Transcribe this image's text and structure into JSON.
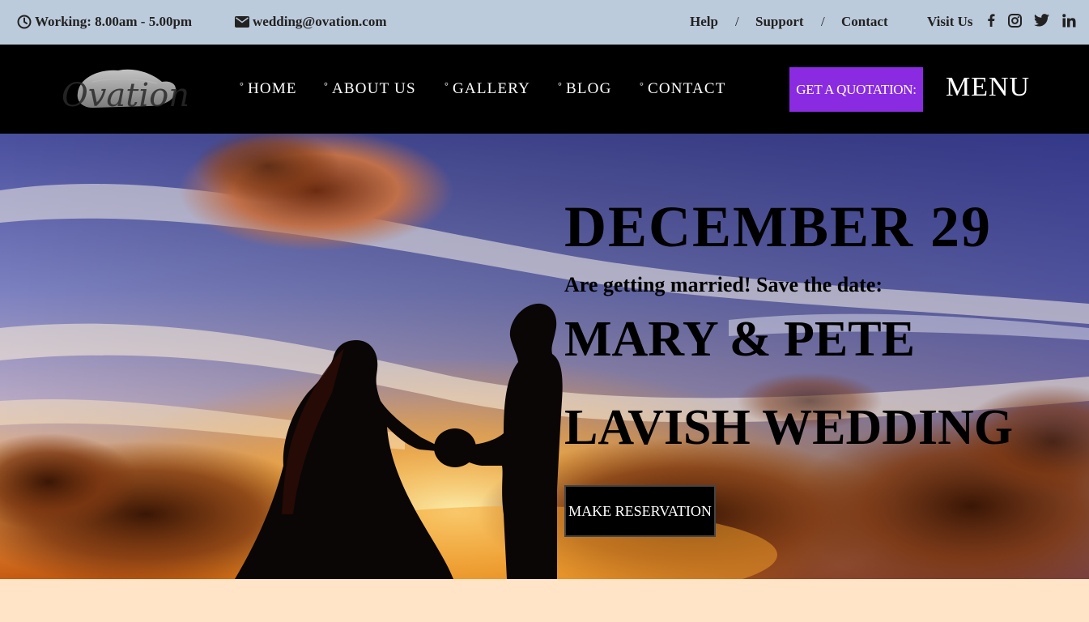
{
  "topbar": {
    "hours": "Working: 8.00am - 5.00pm",
    "email": "wedding@ovation.com",
    "links": {
      "help": "Help",
      "support": "Support",
      "contact": "Contact"
    },
    "separator": "/",
    "visit_us": "Visit Us",
    "social_icons": [
      "facebook-icon",
      "instagram-icon",
      "twitter-icon",
      "linkedin-icon"
    ]
  },
  "navbar": {
    "logo_text": "Ovation",
    "bullet": "°",
    "items": [
      {
        "label": "HOME"
      },
      {
        "label": "ABOUT US"
      },
      {
        "label": "GALLERY"
      },
      {
        "label": "BLOG"
      },
      {
        "label": "CONTACT"
      }
    ],
    "quote_button": "GET A QUOTATION:",
    "menu_label": "MENU"
  },
  "hero": {
    "date": "DECEMBER 29",
    "subtitle": "Are getting married! Save the date:",
    "names": "MARY & PETE",
    "tagline": "LAVISH WEDDING",
    "cta": "MAKE RESERVATION"
  },
  "colors": {
    "topbar_bg": "#bccbdb",
    "navbar_bg": "#000000",
    "accent": "#8a2be2",
    "bottom_bg": "#ffe4c8"
  }
}
